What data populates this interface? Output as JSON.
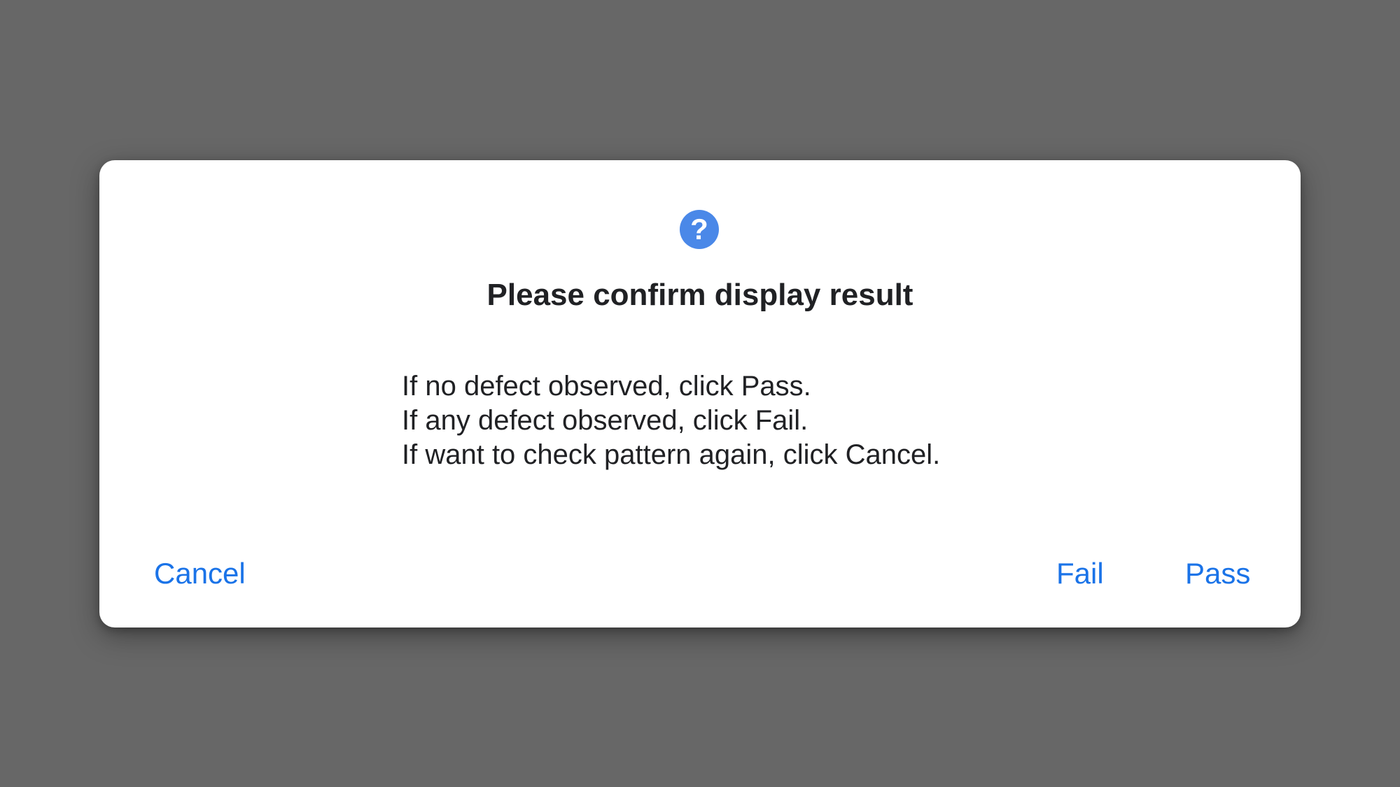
{
  "dialog": {
    "icon": "help-circle-icon",
    "icon_glyph": "?",
    "title": "Please confirm display result",
    "message_lines": [
      "If no defect observed, click Pass.",
      "If any defect observed, click Fail.",
      "If want to check pattern again, click Cancel."
    ],
    "buttons": {
      "cancel": "Cancel",
      "fail": "Fail",
      "pass": "Pass"
    }
  },
  "colors": {
    "backdrop": "#676767",
    "dialog_background": "#ffffff",
    "accent": "#1a73e8",
    "icon_background": "#4a88e8",
    "text": "#202124"
  }
}
